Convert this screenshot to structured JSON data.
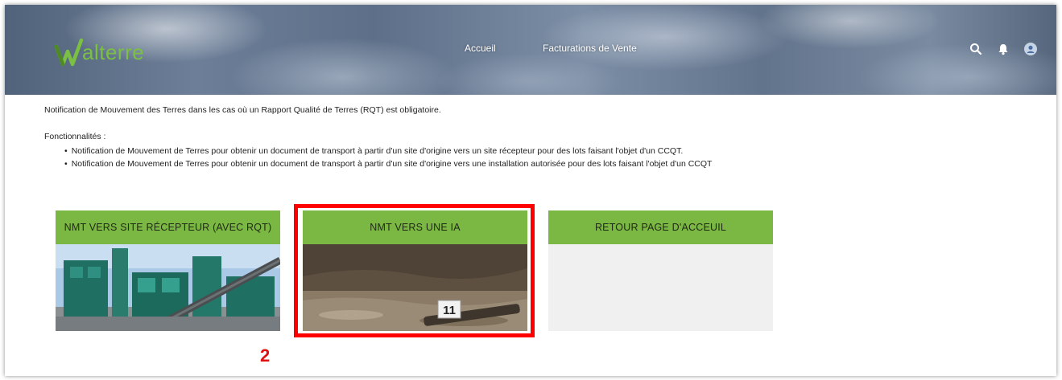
{
  "header": {
    "brand": "alterre",
    "brand_color": "#7bc043",
    "nav": [
      {
        "label": "Accueil"
      },
      {
        "label": "Facturations de Vente"
      }
    ],
    "icons": [
      "search-icon",
      "bell-icon",
      "user-avatar-icon"
    ]
  },
  "intro": {
    "description": "Notification de Mouvement des Terres dans les cas où un Rapport Qualité de Terres (RQT) est obligatoire.",
    "features_title": "Fonctionnalités :",
    "features": [
      "Notification de Mouvement de Terres pour obtenir un document de transport à partir d'un site d'origine vers un site récepteur pour des lots faisant l'objet d'un CCQT.",
      "Notification de Mouvement de Terres pour obtenir un document de transport à partir d'un site d'origine vers une installation autorisée pour des lots faisant l'objet d'un CCQT"
    ]
  },
  "tiles": [
    {
      "label": "NMT VERS SITE RÉCEPTEUR (AVEC RQT)",
      "image": "industrial-plant-photo"
    },
    {
      "label": "NMT VERS UNE IA",
      "image": "soil-sample-photo",
      "image_text": "11"
    },
    {
      "label": "RETOUR PAGE D'ACCEUIL",
      "image": ""
    }
  ],
  "annotation": {
    "step": "2",
    "color": "#ff0000"
  },
  "colors": {
    "tile_header": "#7bb743",
    "tile_body": "#f0f0f0"
  }
}
